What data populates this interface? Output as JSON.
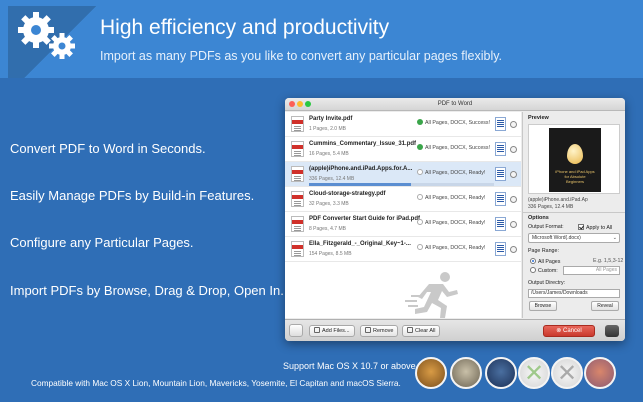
{
  "banner": {
    "headline": "High efficiency and productivity",
    "subline": "Import as many PDFs as you like to convert any particular pages flexibly."
  },
  "features": [
    "Convert PDF to Word in Seconds.",
    "Easily Manage PDFs by Build-in Features.",
    "Configure any Particular Pages.",
    "Import PDFs by Browse, Drag & Drop, Open In."
  ],
  "window": {
    "title": "PDF to Word",
    "files": [
      {
        "name": "Party Invite.pdf",
        "meta": "1 Pages, 2.0 MB",
        "status": "All Pages, DOCX, Success!",
        "state": "success"
      },
      {
        "name": "Cummins_Commentary_Issue_31.pdf",
        "meta": "16 Pages, 5.4 MB",
        "status": "All Pages, DOCX, Success!",
        "state": "success"
      },
      {
        "name": "(apple)iPhone.and.iPad.Apps.for.A...",
        "meta": "336 Pages, 12.4 MB",
        "status": "All Pages, DOCX, Ready!",
        "state": "ready",
        "progress": 0.55
      },
      {
        "name": "Cloud-storage-strategy.pdf",
        "meta": "32 Pages, 3.3 MB",
        "status": "All Pages, DOCX, Ready!",
        "state": "ready"
      },
      {
        "name": "PDF Converter Start Guide for iPad.pdf",
        "meta": "8 Pages, 4.7 MB",
        "status": "All Pages, DOCX, Ready!",
        "state": "ready"
      },
      {
        "name": "Ella_Fitzgerald_-_Original_Key~1-...",
        "meta": "154 Pages, 8.5 MB",
        "status": "All Pages, DOCX, Ready!",
        "state": "ready"
      }
    ],
    "buttons": {
      "add": "Add Files...",
      "remove": "Remove",
      "clear": "Clear All",
      "cancel": "Cancel"
    },
    "preview": {
      "title": "Preview",
      "book_title": "iPhone and iPad Apps for Absolute Beginners",
      "file_name": "(apple)iPhone.and.iPad.Ap",
      "file_meta": "336 Pages, 12.4 MB"
    },
    "options": {
      "title": "Options",
      "output_format_label": "Output Format:",
      "apply_all_label": "Apply to All",
      "output_format_value": "Microsoft Word(.docx)",
      "page_range_label": "Page Range:",
      "all_pages_label": "All Pages",
      "example_text": "E.g. 1,5,3-12",
      "custom_label": "Custom:",
      "custom_placeholder": "All Pages",
      "output_dir_label": "Output Directry:",
      "output_dir_value": "/Users/James/Downloads",
      "browse_label": "Browse",
      "reveal_label": "Reveal"
    }
  },
  "footer": {
    "support": "Support Mac OS X 10.7 or above.",
    "compat": "Compatible with Mac OS X Lion, Mountain Lion, Mavericks, Yosemite, El Capitan and macOS Sierra."
  },
  "colors": {
    "background": "#2f6eb6",
    "banner": "#3c86d3",
    "cancel": "#d8463a",
    "success": "#3aa54a"
  }
}
